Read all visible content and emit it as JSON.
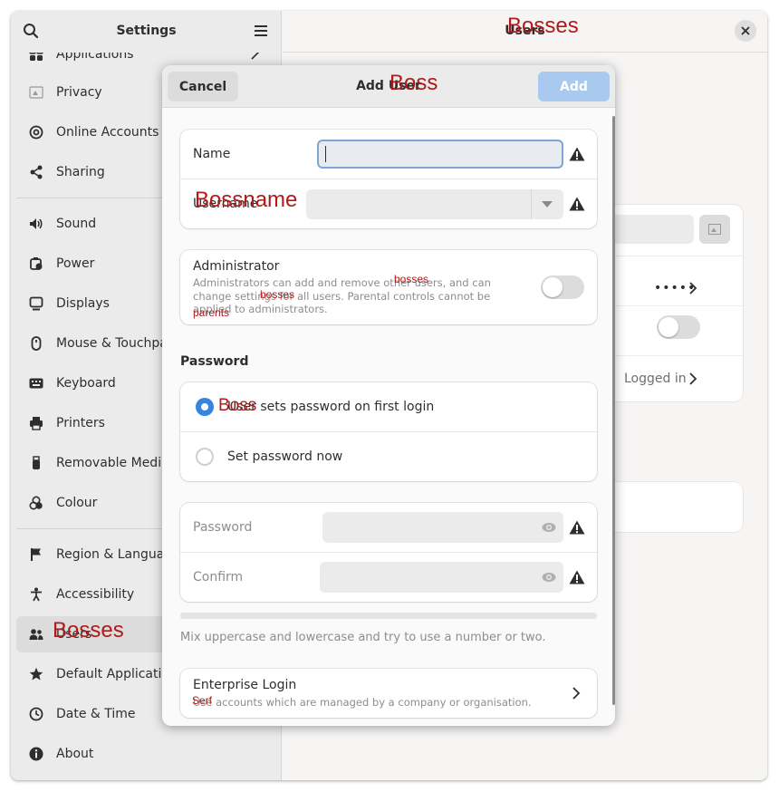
{
  "window": {
    "title": "Settings"
  },
  "sidebar": {
    "items": [
      {
        "label": "Applications",
        "icon": "applications-icon"
      },
      {
        "label": "Privacy",
        "icon": "privacy-icon"
      },
      {
        "label": "Online Accounts",
        "icon": "online-accounts-icon"
      },
      {
        "label": "Sharing",
        "icon": "sharing-icon"
      },
      {
        "label": "Sound",
        "icon": "sound-icon"
      },
      {
        "label": "Power",
        "icon": "power-icon"
      },
      {
        "label": "Displays",
        "icon": "displays-icon"
      },
      {
        "label": "Mouse & Touchpad",
        "icon": "mouse-icon"
      },
      {
        "label": "Keyboard",
        "icon": "keyboard-icon"
      },
      {
        "label": "Printers",
        "icon": "printer-icon"
      },
      {
        "label": "Removable Media",
        "icon": "usb-icon"
      },
      {
        "label": "Colour",
        "icon": "colour-icon"
      },
      {
        "label": "Region & Language",
        "icon": "flag-icon"
      },
      {
        "label": "Accessibility",
        "icon": "accessibility-icon"
      },
      {
        "label": "Users",
        "icon": "users-icon",
        "selected": true
      },
      {
        "label": "Default Applications",
        "icon": "star-icon"
      },
      {
        "label": "Date & Time",
        "icon": "clock-icon"
      },
      {
        "label": "About",
        "icon": "info-icon"
      }
    ]
  },
  "content": {
    "title": "Users",
    "autologin_value": "Logged in",
    "password_dots": "•••••"
  },
  "overlays": {
    "header_bosses": "Bosses",
    "dialog_boss": "Boss",
    "username": "Bossname",
    "admin_bosses_1": "bosses",
    "admin_bosses_2": "bosses",
    "admin_parents": "parents",
    "radio_boss": "Boss",
    "sidebar_bosses": "Bosses",
    "enterprise_serf": "Serf"
  },
  "dialog": {
    "title": "Add User",
    "cancel_label": "Cancel",
    "add_label": "Add",
    "name_label": "Name",
    "username_label": "Username",
    "admin": {
      "title": "Administrator",
      "description": "Administrators can add and remove other users, and can change settings for all users. Parental controls cannot be applied to administrators.",
      "enabled": false
    },
    "password_section": {
      "title": "Password",
      "option_first_login": "User sets password on first login",
      "option_now": "Set password now",
      "selected": "first_login"
    },
    "password_label": "Password",
    "confirm_label": "Confirm",
    "password_hint": "Mix uppercase and lowercase and try to use a number or two.",
    "enterprise": {
      "title": "Enterprise Login",
      "subtitle": "Use accounts which are managed by a company or organisation."
    }
  }
}
